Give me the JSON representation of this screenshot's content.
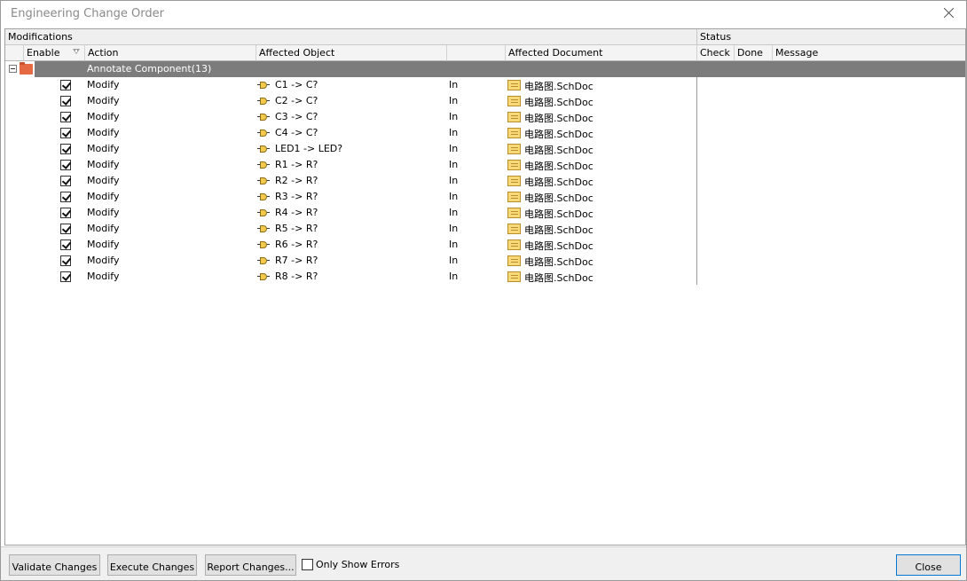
{
  "window": {
    "title": "Engineering Change Order"
  },
  "groups": {
    "modifications": "Modifications",
    "status": "Status"
  },
  "columns": {
    "enable": "Enable",
    "action": "Action",
    "affected_object": "Affected Object",
    "affected_document": "Affected Document",
    "check": "Check",
    "done": "Done",
    "message": "Message"
  },
  "group_row": {
    "label": "Annotate Component(13)"
  },
  "rows": [
    {
      "enabled": true,
      "action": "Modify",
      "object": "C1 -> C?",
      "direction": "In",
      "document": "电路图.SchDoc"
    },
    {
      "enabled": true,
      "action": "Modify",
      "object": "C2 -> C?",
      "direction": "In",
      "document": "电路图.SchDoc"
    },
    {
      "enabled": true,
      "action": "Modify",
      "object": "C3 -> C?",
      "direction": "In",
      "document": "电路图.SchDoc"
    },
    {
      "enabled": true,
      "action": "Modify",
      "object": "C4 -> C?",
      "direction": "In",
      "document": "电路图.SchDoc"
    },
    {
      "enabled": true,
      "action": "Modify",
      "object": "LED1 -> LED?",
      "direction": "In",
      "document": "电路图.SchDoc"
    },
    {
      "enabled": true,
      "action": "Modify",
      "object": "R1 -> R?",
      "direction": "In",
      "document": "电路图.SchDoc"
    },
    {
      "enabled": true,
      "action": "Modify",
      "object": "R2 -> R?",
      "direction": "In",
      "document": "电路图.SchDoc"
    },
    {
      "enabled": true,
      "action": "Modify",
      "object": "R3 -> R?",
      "direction": "In",
      "document": "电路图.SchDoc"
    },
    {
      "enabled": true,
      "action": "Modify",
      "object": "R4 -> R?",
      "direction": "In",
      "document": "电路图.SchDoc"
    },
    {
      "enabled": true,
      "action": "Modify",
      "object": "R5 -> R?",
      "direction": "In",
      "document": "电路图.SchDoc"
    },
    {
      "enabled": true,
      "action": "Modify",
      "object": "R6 -> R?",
      "direction": "In",
      "document": "电路图.SchDoc"
    },
    {
      "enabled": true,
      "action": "Modify",
      "object": "R7 -> R?",
      "direction": "In",
      "document": "电路图.SchDoc"
    },
    {
      "enabled": true,
      "action": "Modify",
      "object": "R8 -> R?",
      "direction": "In",
      "document": "电路图.SchDoc"
    }
  ],
  "buttons": {
    "validate": "Validate Changes",
    "execute": "Execute Changes",
    "report": "Report Changes...",
    "close": "Close"
  },
  "only_show_errors": {
    "label": "Only Show Errors",
    "checked": false
  },
  "icons": {
    "close": "close-icon",
    "filter": "filter-icon",
    "expander": "collapse-icon",
    "folder": "folder-icon",
    "component": "component-icon",
    "document": "schematic-document-icon"
  }
}
